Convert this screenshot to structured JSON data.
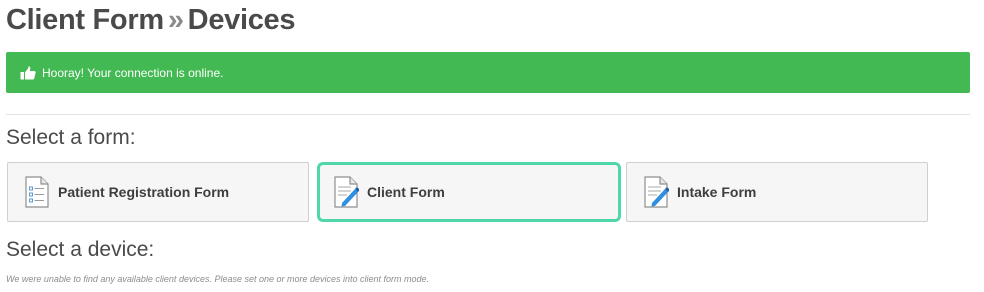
{
  "header": {
    "title_part1": "Client Form",
    "separator": "»",
    "title_part2": "Devices"
  },
  "alert": {
    "message": "Hooray! Your connection is online.",
    "icon": "thumbs-up-icon",
    "color": "#43b953"
  },
  "forms_section": {
    "heading": "Select a form:",
    "forms": [
      {
        "label": "Patient Registration Form",
        "icon": "checklist-document-icon",
        "selected": false
      },
      {
        "label": "Client Form",
        "icon": "document-pen-icon",
        "selected": true
      },
      {
        "label": "Intake Form",
        "icon": "document-pen-icon",
        "selected": false
      }
    ],
    "selected_border_color": "#4fd7aa"
  },
  "devices_section": {
    "heading": "Select a device:",
    "empty_message": "We were unable to find any available client devices. Please set one or more devices into client form mode."
  }
}
